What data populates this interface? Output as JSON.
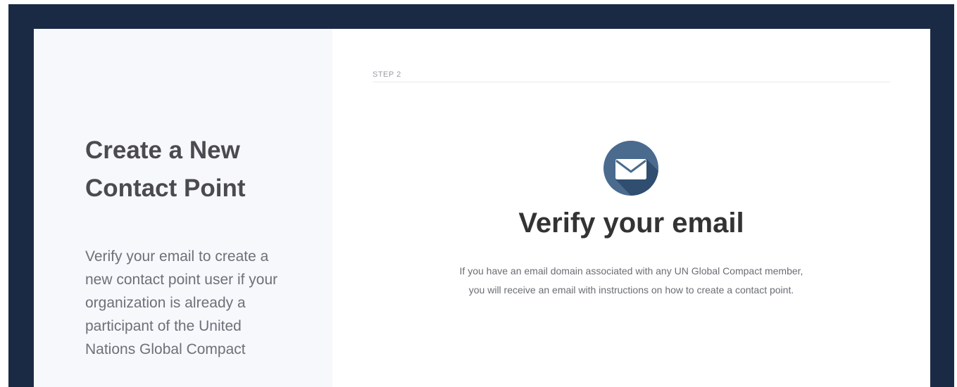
{
  "left_panel": {
    "title": "Create a New Contact Point",
    "description": "Verify your email to create a new contact point user if your organization is already a participant of the United Nations Global Compact"
  },
  "main": {
    "step_label": "STEP 2",
    "icon": "envelope-icon",
    "heading": "Verify your email",
    "message_line1": "If you have an email domain associated with any UN Global Compact member,",
    "message_line2": "you will receive an email with instructions on how to create a contact point."
  },
  "colors": {
    "frame_background": "#1b2a44",
    "left_panel_background": "#f6f8fc",
    "icon_circle": "#4a6b8e",
    "icon_shadow": "#2f4e70"
  }
}
